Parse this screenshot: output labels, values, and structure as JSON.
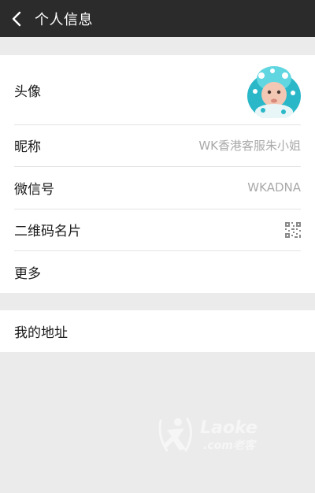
{
  "header": {
    "title": "个人信息",
    "back_icon": "chevron-left-icon"
  },
  "profile": {
    "avatar_label": "头像",
    "nickname_label": "昵称",
    "nickname_value": "WK香港客服朱小姐",
    "wechat_id_label": "微信号",
    "wechat_id_value": "WKADNA",
    "qrcode_label": "二维码名片",
    "more_label": "更多"
  },
  "address": {
    "label": "我的地址"
  },
  "watermark": {
    "brand": "Laoke",
    "sub": ".com老客"
  },
  "colors": {
    "topbar": "#2b2b2b",
    "background": "#ebebeb",
    "value_text": "#a9a9a9"
  }
}
